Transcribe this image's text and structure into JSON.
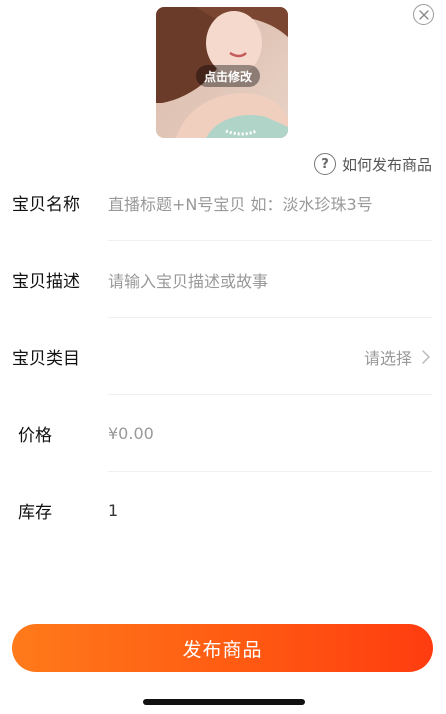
{
  "cover": {
    "edit_label": "点击修改"
  },
  "help": {
    "icon": "question-circle-icon",
    "label": "如何发布商品"
  },
  "form": {
    "name": {
      "label": "宝贝名称",
      "placeholder": "直播标题+N号宝贝 如：淡水珍珠3号"
    },
    "description": {
      "label": "宝贝描述",
      "placeholder": "请输入宝贝描述或故事"
    },
    "category": {
      "label": "宝贝类目",
      "select_text": "请选择"
    },
    "price": {
      "label": "价格",
      "placeholder": "¥0.00"
    },
    "stock": {
      "label": "库存",
      "value": "1"
    }
  },
  "publish_label": "发布商品",
  "colors": {
    "accent_start": "#ff7a1a",
    "accent_end": "#ff3c10"
  }
}
